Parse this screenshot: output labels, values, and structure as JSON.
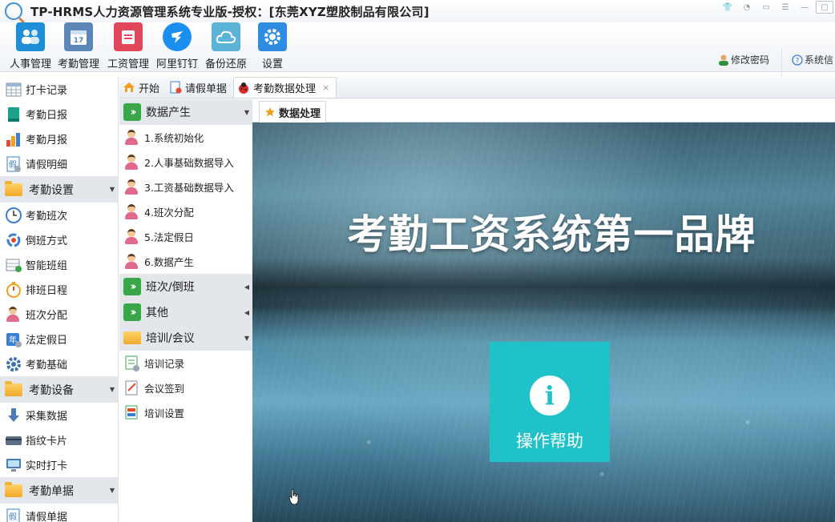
{
  "window": {
    "title": "TP-HRMS人力资源管理系统专业版-授权：[东莞XYZ塑胶制品有限公司]"
  },
  "toolbar": {
    "buttons": [
      {
        "label": "人事管理",
        "icon": "people-icon",
        "color": "#1e8fd6"
      },
      {
        "label": "考勤管理",
        "icon": "calendar-icon",
        "color": "#5c86b5"
      },
      {
        "label": "工资管理",
        "icon": "salary-book-icon",
        "color": "#e0485a"
      },
      {
        "label": "阿里钉钉",
        "icon": "dingtalk-icon",
        "color": "#1a8ff0"
      },
      {
        "label": "备份还原",
        "icon": "cloud-icon",
        "color": "#5bb4d8"
      },
      {
        "label": "设置",
        "icon": "gear-icon",
        "color": "#2f8ce0"
      }
    ],
    "change_password": "修改密码",
    "system_info": "系统信"
  },
  "leftnav": {
    "items_top": [
      "打卡记录",
      "考勤日报",
      "考勤月报",
      "请假明细"
    ],
    "group1": "考勤设置",
    "items_group1": [
      "考勤班次",
      "倒班方式",
      "智能班组",
      "排班日程",
      "班次分配",
      "法定假日",
      "考勤基础"
    ],
    "group2": "考勤设备",
    "items_group2": [
      "采集数据",
      "指纹卡片",
      "实时打卡"
    ],
    "group3": "考勤单据",
    "items_group3": [
      "请假单据"
    ]
  },
  "tabs": [
    {
      "label": "开始"
    },
    {
      "label": "请假单据"
    },
    {
      "label": "考勤数据处理",
      "active": true,
      "close": "×"
    }
  ],
  "subtab": {
    "label": "数据处理"
  },
  "midnav": {
    "group_data": "数据产生",
    "data_items": [
      "1.系统初始化",
      "2.人事基础数据导入",
      "3.工资基础数据导入",
      "4.班次分配",
      "5.法定假日",
      "6.数据产生"
    ],
    "group_shift": "班次/倒班",
    "group_other": "其他",
    "group_training": "培训/会议",
    "training_items": [
      "培训记录",
      "会议签到",
      "培训设置"
    ]
  },
  "hero": {
    "title": "考勤工资系统第一品牌",
    "help_label": "操作帮助",
    "help_icon_glyph": "i"
  }
}
